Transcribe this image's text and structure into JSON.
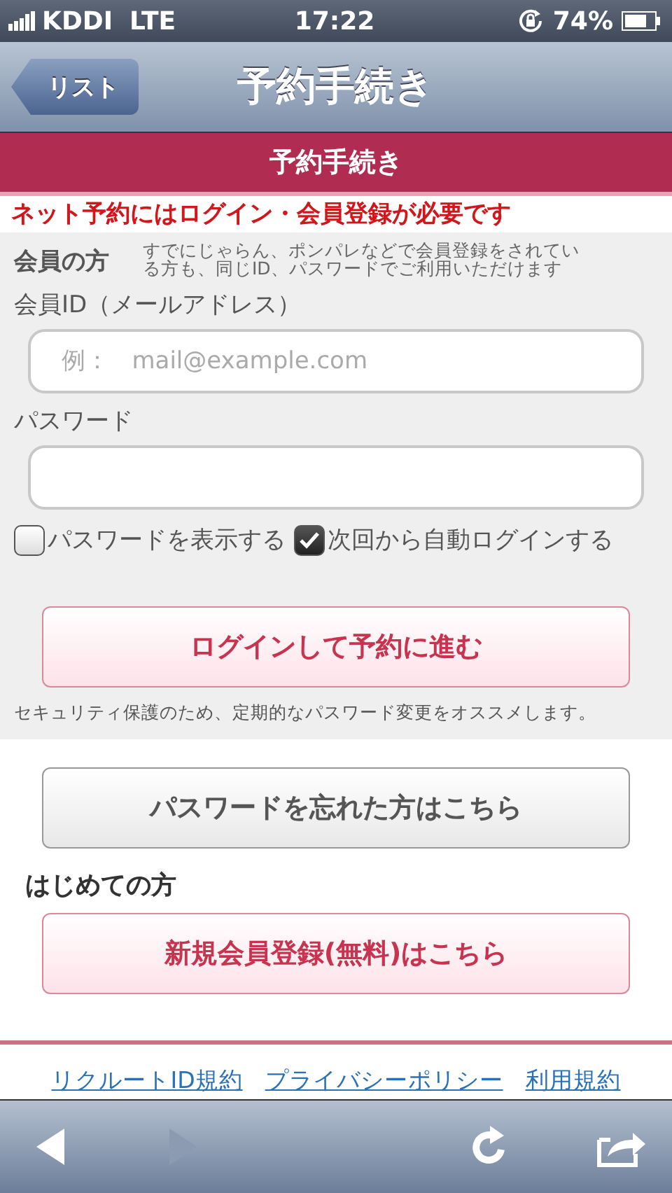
{
  "status_bar": {
    "carrier": "KDDI",
    "network": "LTE",
    "time": "17:22",
    "battery": "74%"
  },
  "nav_bar": {
    "back": "リスト",
    "title": "予約手続き"
  },
  "section_header": "予約手続き",
  "notice": "ネット予約にはログイン・会員登録が必要です",
  "member": {
    "heading": "会員の方",
    "note": "すでにじゃらん、ポンパレなどで会員登録をされている方も、同じID、パスワードでご利用いただけます"
  },
  "fields": [
    {
      "label": "会員ID（メールアドレス）",
      "placeholder": "例：   mail@example.com"
    },
    {
      "label": "パスワード"
    }
  ],
  "options": [
    {
      "label": "パスワードを表示する",
      "checked": false
    },
    {
      "label": "次回から自動ログインする",
      "checked": true
    }
  ],
  "login_button": "ログインして予約に進む",
  "security_note": "セキュリティ保護のため、定期的なパスワード変更をオススメします。",
  "forgot_button": "パスワードを忘れた方はこちら",
  "new_heading": "はじめての方",
  "register_button": "新規会員登録(無料)はこちら",
  "footer_links": [
    "リクルートID規約",
    "プライバシーポリシー",
    "利用規約"
  ],
  "toolbar": [
    {
      "kind": "back",
      "disabled": false
    },
    {
      "kind": "forward",
      "disabled": true
    },
    {
      "kind": "reload",
      "disabled": false
    },
    {
      "kind": "share",
      "disabled": false
    }
  ]
}
